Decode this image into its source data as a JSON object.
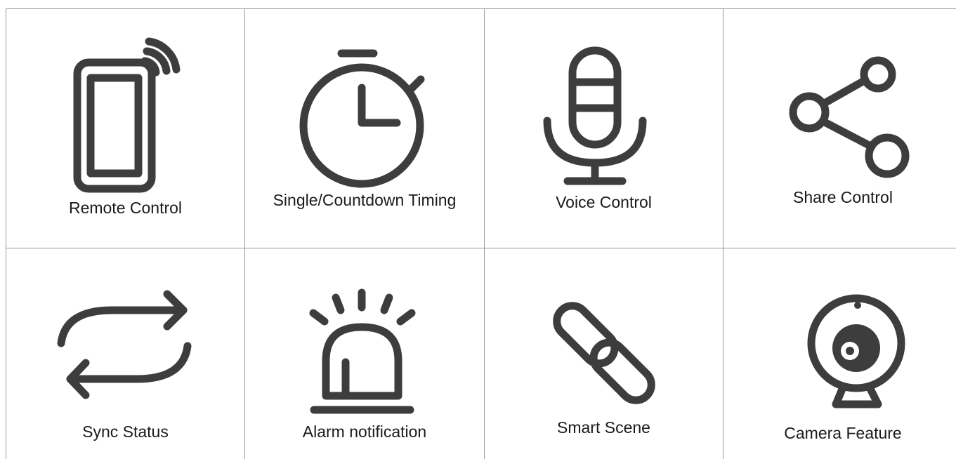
{
  "features": [
    {
      "id": "remote",
      "label": "Remote Control",
      "icon": "phone-signal-icon"
    },
    {
      "id": "timing",
      "label": "Single/Countdown Timing",
      "icon": "stopwatch-icon"
    },
    {
      "id": "voice",
      "label": "Voice Control",
      "icon": "microphone-icon"
    },
    {
      "id": "share",
      "label": "Share Control",
      "icon": "share-icon"
    },
    {
      "id": "sync",
      "label": "Sync Status",
      "icon": "sync-arrows-icon"
    },
    {
      "id": "alarm",
      "label": "Alarm notification",
      "icon": "siren-icon"
    },
    {
      "id": "scene",
      "label": "Smart Scene",
      "icon": "link-icon"
    },
    {
      "id": "camera",
      "label": "Camera Feature",
      "icon": "webcam-icon"
    }
  ],
  "colors": {
    "icon": "#3d3d3d",
    "border": "#9a9a9a",
    "text": "#1a1a1a"
  }
}
